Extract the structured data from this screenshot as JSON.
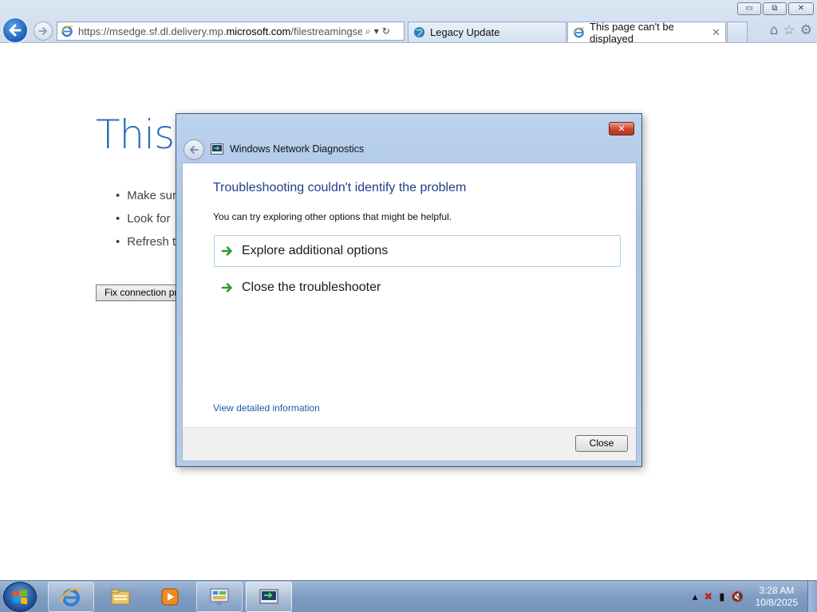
{
  "browser": {
    "window_buttons": {
      "minimize": "▭",
      "restore": "⧉",
      "close": "✕"
    },
    "address_bar": {
      "url_prefix": "https://msedge.sf.dl.delivery.mp.",
      "url_domain": "microsoft.com",
      "url_suffix": "/filestreamingservic",
      "icons": {
        "search": "⌕",
        "dropdown": "▾",
        "refresh": "↻"
      }
    },
    "tabs": [
      {
        "label": "Legacy Update",
        "active": false,
        "icon": "globe-icon"
      },
      {
        "label": "This page can't be displayed",
        "active": true,
        "icon": "ie-icon",
        "close": "✕"
      }
    ],
    "tools": {
      "home": "⌂",
      "favorites": "☆",
      "settings": "⚙"
    }
  },
  "page": {
    "title": "This",
    "bullets": [
      "Make sur",
      "Look for",
      "Refresh t"
    ],
    "fix_button": "Fix connection pr"
  },
  "dialog": {
    "close_glyph": "✕",
    "title": "Windows Network Diagnostics",
    "heading": "Troubleshooting couldn't identify the problem",
    "subtext": "You can try exploring other options that might be helpful.",
    "options": [
      {
        "label": "Explore additional options",
        "highlighted": true
      },
      {
        "label": "Close the troubleshooter",
        "highlighted": false
      }
    ],
    "detail_link": "View detailed information",
    "close_button": "Close"
  },
  "taskbar": {
    "items": [
      {
        "name": "internet-explorer",
        "state": "pinned"
      },
      {
        "name": "file-explorer",
        "state": "normal"
      },
      {
        "name": "media-player",
        "state": "normal"
      },
      {
        "name": "control-panel",
        "state": "pinned"
      },
      {
        "name": "network-diagnostics",
        "state": "active"
      }
    ],
    "tray": {
      "expand": "▴",
      "network": "✖",
      "power": "▮",
      "volume": "🔇"
    },
    "clock": {
      "time": "3:28 AM",
      "date": "10/8/2025"
    }
  },
  "colors": {
    "accent_blue": "#2a6ec0",
    "dialog_heading": "#1e3f8c",
    "link": "#1c5bab",
    "arrow_green": "#2e9b2e"
  }
}
